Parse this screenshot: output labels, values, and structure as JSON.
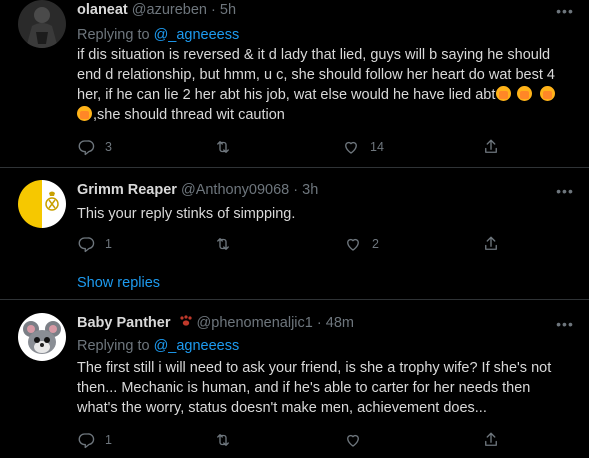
{
  "tweets": [
    {
      "name": "olaneat",
      "handle": "@azureben",
      "sep": "·",
      "time": "5h",
      "replying_prefix": "Replying to ",
      "replying_to": "@_agneeess",
      "text_line1": "if dis situation is reversed & it d lady that lied, guys will b saying he should",
      "text_line2": "end d relationship, but hmm, u c, she should follow her heart do wat best 4",
      "text_line3": "her, if he can lie 2 her abt his job, wat else would he have lied abt",
      "text_line4": ",she should thread wit caution",
      "reply_count": "3",
      "retweet_count": "",
      "like_count": "14"
    },
    {
      "name": "Grimm Reaper",
      "handle": "@Anthony09068",
      "sep": "·",
      "time": "3h",
      "text_line1": "This your reply stinks of simpping.",
      "reply_count": "1",
      "retweet_count": "",
      "like_count": "2"
    },
    {
      "name": "Baby Panther",
      "handle": "@phenomenaljic1",
      "sep": "·",
      "time": "48m",
      "replying_prefix": "Replying to ",
      "replying_to": "@_agneeess",
      "text_line1": "The first still i will need to ask your friend, is she a trophy wife? If she's not",
      "text_line2": "then... Mechanic is human, and if he's able to carter for her needs then",
      "text_line3": "what's the worry, status doesn't make men, achievement does...",
      "reply_count": "1",
      "retweet_count": "",
      "like_count": ""
    }
  ],
  "show_replies": "Show replies",
  "more_glyph": "•••",
  "colors": {
    "background": "#000000",
    "text": "#d9d9d9",
    "muted": "#6e767d",
    "link": "#1d9bf0",
    "divider": "#2f3336"
  },
  "icons": [
    "reply-icon",
    "retweet-icon",
    "like-icon",
    "share-icon",
    "more-icon",
    "paw-icon",
    "avatar-icon"
  ]
}
